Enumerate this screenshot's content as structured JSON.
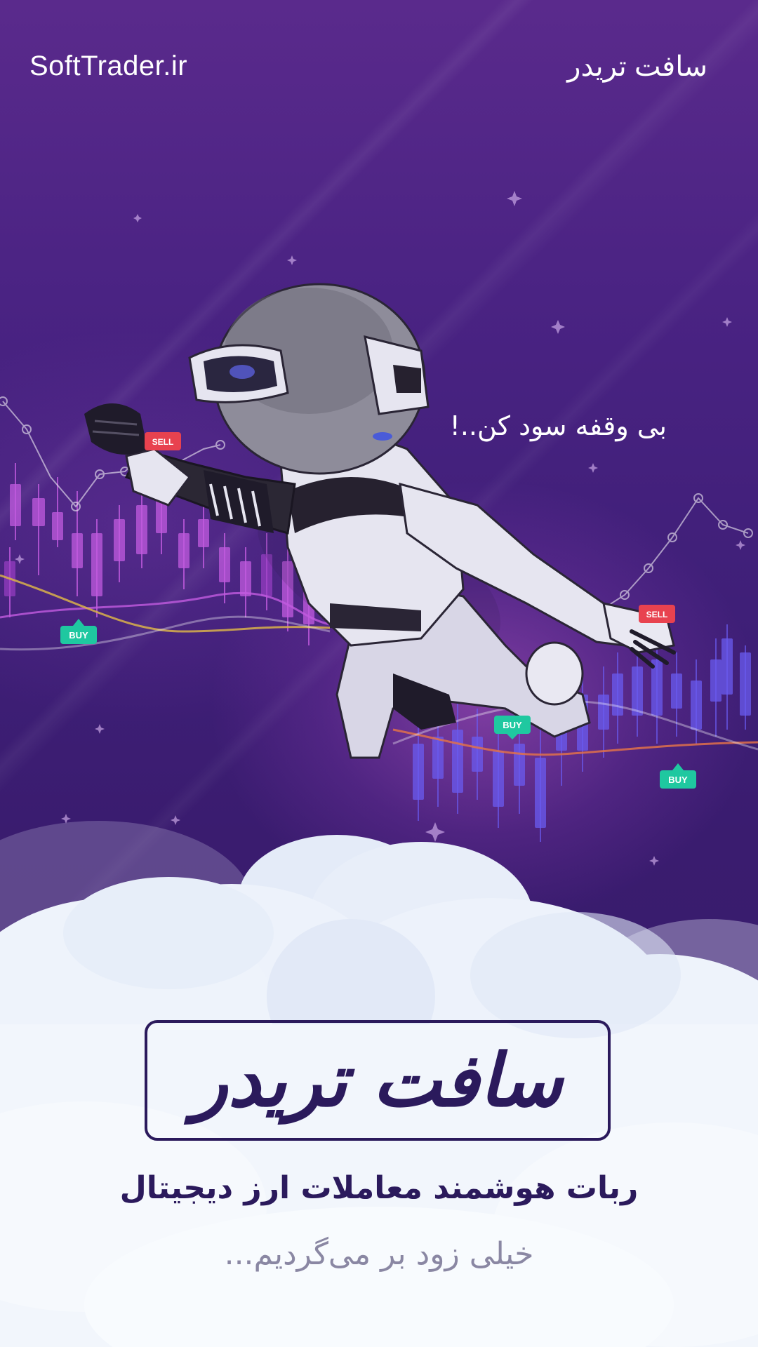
{
  "header": {
    "site_domain": "SoftTrader.ir",
    "brand_short": "سافت تریدر"
  },
  "hero": {
    "tagline": "بی وقفه سود کن..!",
    "signals": {
      "buy_label": "BUY",
      "sell_label": "SELL"
    }
  },
  "footer": {
    "brand_name": "سافت تریدر",
    "subtitle": "ربات هوشمند معاملات ارز دیجیتال",
    "coming_soon": "خیلی زود بر می‌گردیم..."
  },
  "colors": {
    "background_top": "#5a2a8c",
    "background_bottom": "#35196a",
    "brand_dark": "#2b1a5c",
    "buy_green": "#1fc8a0",
    "sell_red": "#e8424f",
    "candle_pink": "#c25be0",
    "candle_violet": "#6a5bf0",
    "cloud": "#eef3fb"
  },
  "icons": {
    "robot": "flying-robot-illustration",
    "sparkle": "sparkle-star-icon"
  }
}
